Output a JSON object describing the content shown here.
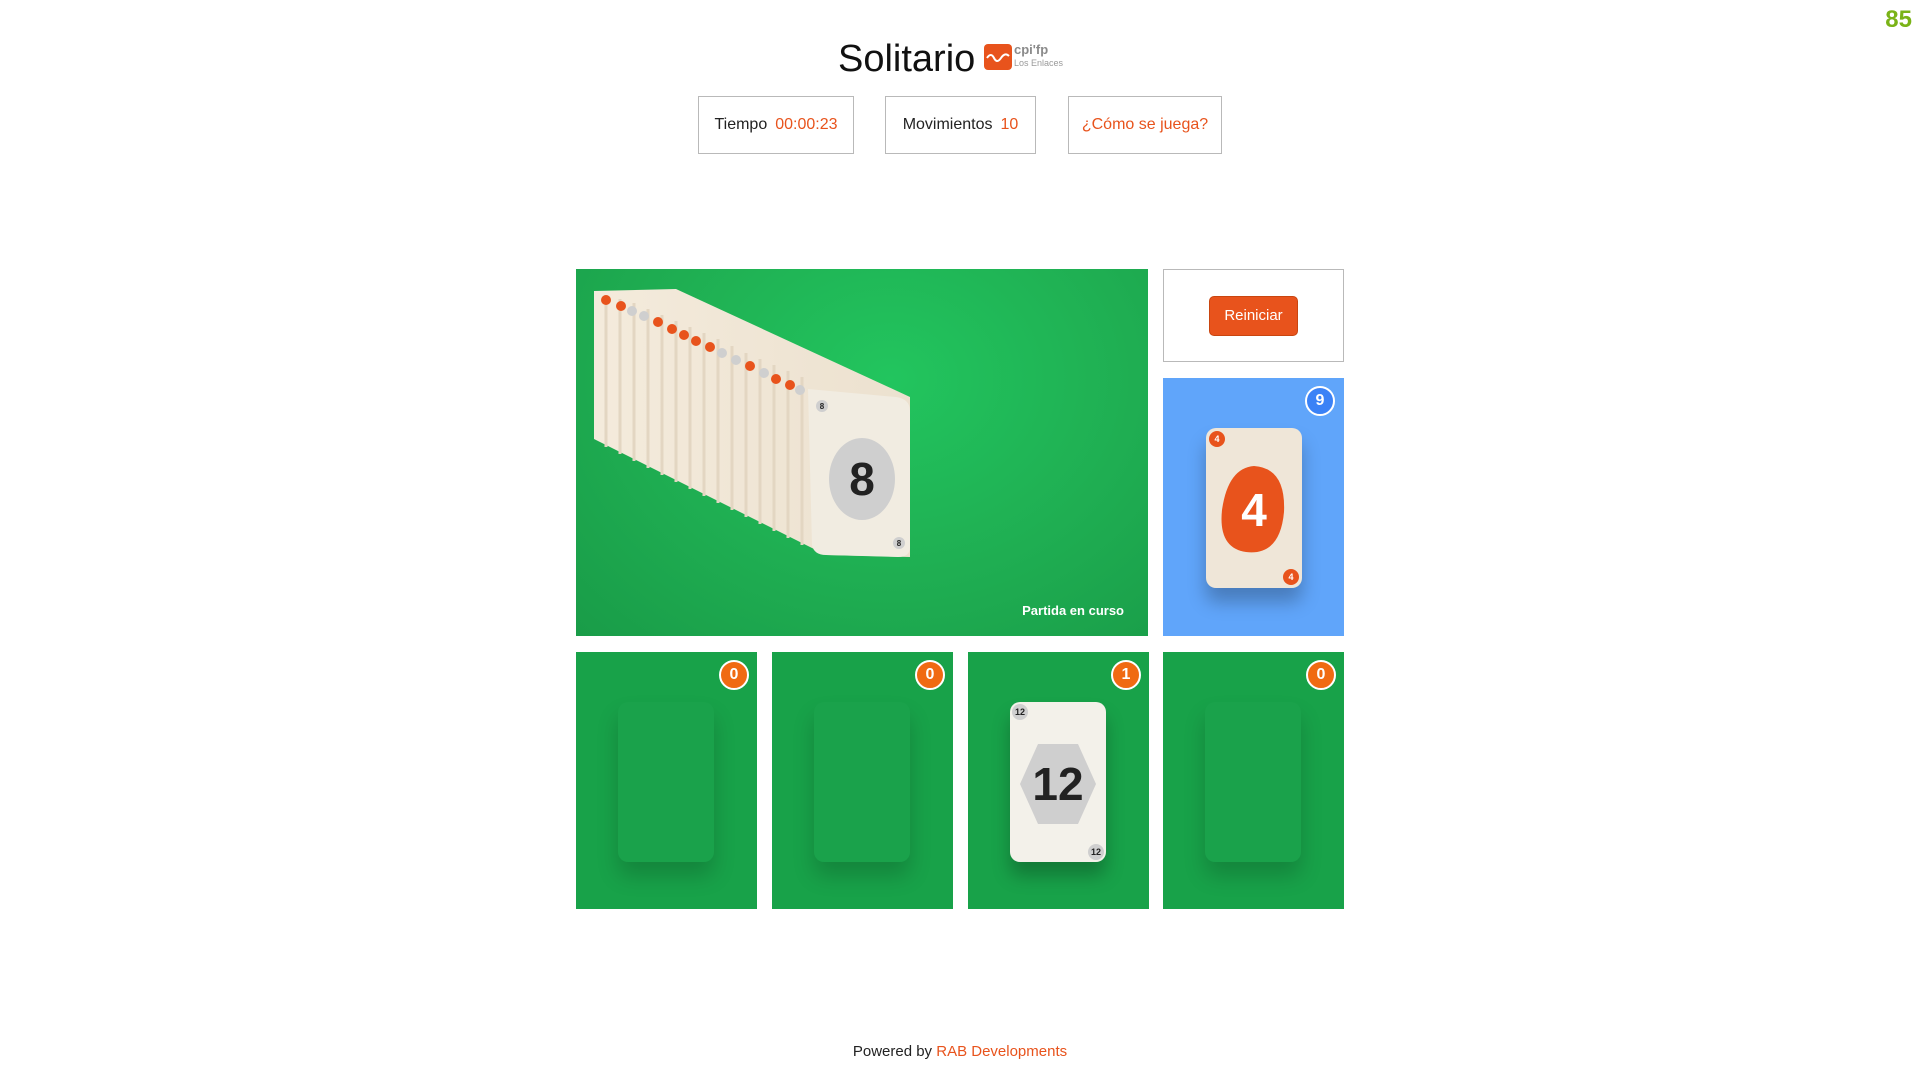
{
  "score": "85",
  "header": {
    "title": "Solitario",
    "logo_text": "cpi'fp",
    "logo_sub": "Los Enlaces"
  },
  "stats": {
    "time_label": "Tiempo",
    "time_value": "00:00:23",
    "moves_label": "Movimientos",
    "moves_value": "10",
    "help_label": "¿Cómo se juega?"
  },
  "stock": {
    "status": "Partida en curso",
    "top_card": "8"
  },
  "restart_label": "Reiniciar",
  "discard": {
    "count": "9",
    "card_value": "4"
  },
  "foundations": [
    {
      "count": "0",
      "card": ""
    },
    {
      "count": "0",
      "card": ""
    },
    {
      "count": "1",
      "card": "12"
    },
    {
      "count": "0",
      "card": ""
    }
  ],
  "footer": {
    "prefix": "Powered by",
    "link": "RAB Developments"
  },
  "colors": {
    "accent": "#e8531c",
    "table_green": "#18a249",
    "discard_blue": "#60a5fa",
    "score_green": "#7ab317"
  }
}
